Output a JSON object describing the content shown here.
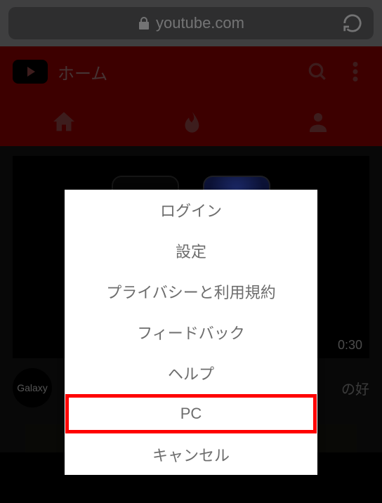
{
  "browser": {
    "domain": "youtube.com"
  },
  "header": {
    "section_label": "ホーム"
  },
  "video": {
    "duration": "0:30",
    "channel_name": "Galaxy",
    "title_visible_fragment": "の好"
  },
  "menu": {
    "items": [
      {
        "label": "ログイン",
        "key": "login"
      },
      {
        "label": "設定",
        "key": "settings"
      },
      {
        "label": "プライバシーと利用規約",
        "key": "privacy-terms"
      },
      {
        "label": "フィードバック",
        "key": "feedback"
      },
      {
        "label": "ヘルプ",
        "key": "help"
      },
      {
        "label": "PC",
        "key": "desktop",
        "highlighted": true
      },
      {
        "label": "キャンセル",
        "key": "cancel"
      }
    ]
  }
}
